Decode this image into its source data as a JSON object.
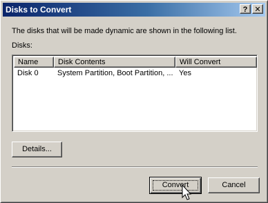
{
  "window": {
    "title": "Disks to Convert",
    "help_glyph": "?",
    "close_glyph": "✕"
  },
  "description": "The disks that will be made dynamic are shown in the following list.",
  "disks_label": "Disks:",
  "list": {
    "columns": [
      "Name",
      "Disk Contents",
      "Will Convert"
    ],
    "rows": [
      [
        "Disk 0",
        "System Partition, Boot Partition, ...",
        "Yes"
      ]
    ]
  },
  "buttons": {
    "details": "Details...",
    "convert": "Convert",
    "cancel": "Cancel"
  },
  "colors": {
    "face": "#d4d0c8",
    "title_start": "#0a246a",
    "title_end": "#a6caf0"
  },
  "icons": {
    "cursor": "arrow-cursor-icon"
  }
}
